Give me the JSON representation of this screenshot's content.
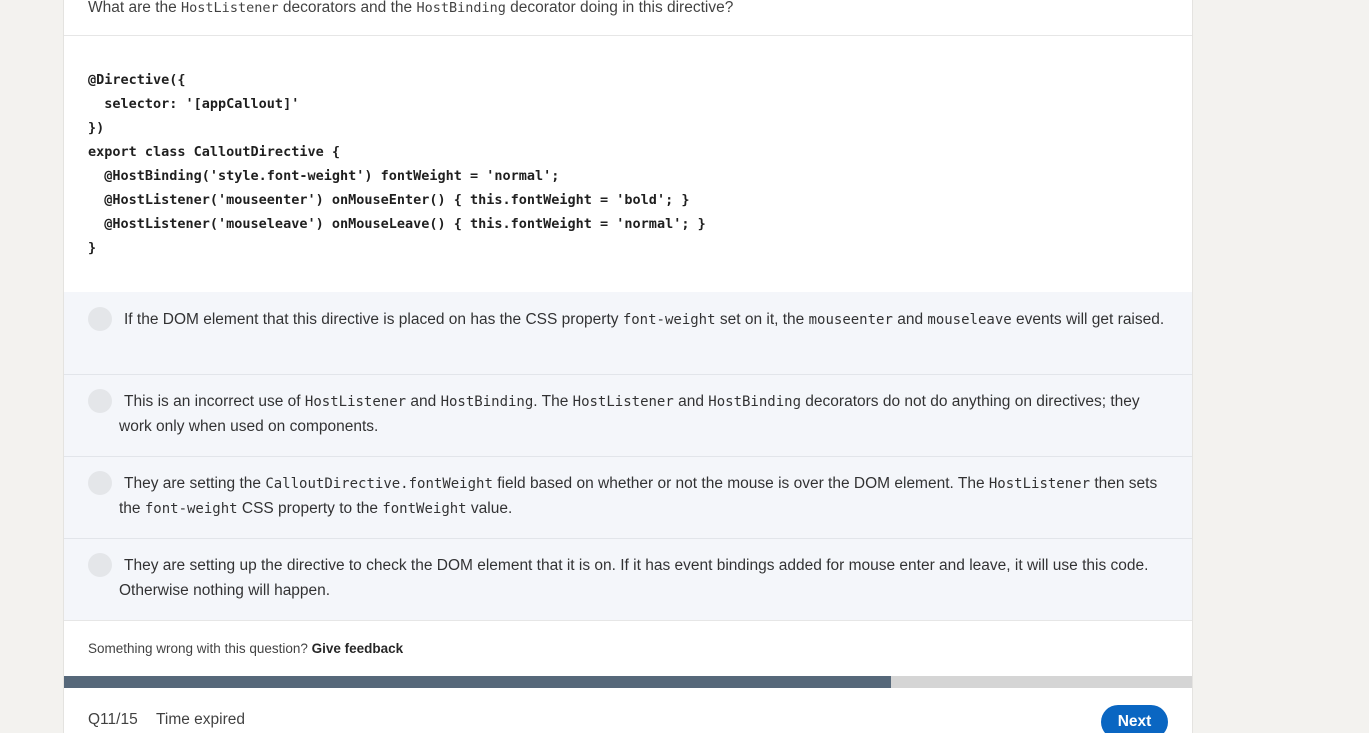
{
  "question": {
    "prefix": "What are the ",
    "code1": "HostListener",
    "middle": " decorators and the ",
    "code2": "HostBinding",
    "suffix": " decorator doing in this directive?"
  },
  "code_block": "@Directive({\n  selector: '[appCallout]'\n})\nexport class CalloutDirective {\n  @HostBinding('style.font-weight') fontWeight = 'normal';\n  @HostListener('mouseenter') onMouseEnter() { this.fontWeight = 'bold'; }\n  @HostListener('mouseleave') onMouseLeave() { this.fontWeight = 'normal'; }\n}",
  "options": [
    {
      "segments": [
        {
          "t": "If the DOM element that this directive is placed on has the CSS property "
        },
        {
          "t": "font-weight",
          "code": true
        },
        {
          "t": " set on it, the "
        },
        {
          "t": "mouseenter",
          "code": true
        },
        {
          "t": " and "
        },
        {
          "t": "mouseleave",
          "code": true
        },
        {
          "t": " events will get raised."
        }
      ]
    },
    {
      "segments": [
        {
          "t": "This is an incorrect use of "
        },
        {
          "t": "HostListener",
          "code": true
        },
        {
          "t": " and "
        },
        {
          "t": "HostBinding",
          "code": true
        },
        {
          "t": ". The "
        },
        {
          "t": "HostListener",
          "code": true
        },
        {
          "t": " and "
        },
        {
          "t": "HostBinding",
          "code": true
        },
        {
          "t": " decorators do not do anything on directives; they work only when used on components."
        }
      ]
    },
    {
      "segments": [
        {
          "t": "They are setting the "
        },
        {
          "t": "CalloutDirective.fontWeight",
          "code": true
        },
        {
          "t": " field based on whether or not the mouse is over the DOM element. The "
        },
        {
          "t": "HostListener",
          "code": true
        },
        {
          "t": " then sets the "
        },
        {
          "t": "font-weight",
          "code": true
        },
        {
          "t": " CSS property to the "
        },
        {
          "t": "fontWeight",
          "code": true
        },
        {
          "t": " value."
        }
      ]
    },
    {
      "segments": [
        {
          "t": "They are setting up the directive to check the DOM element that it is on. If it has event bindings added for mouse enter and leave, it will use this code. Otherwise nothing will happen."
        }
      ]
    }
  ],
  "feedback": {
    "text": "Something wrong with this question? ",
    "link": "Give feedback"
  },
  "progress": {
    "fraction": 0.733
  },
  "footer": {
    "question_counter": "Q11/15",
    "timer": "Time expired",
    "next_label": "Next"
  }
}
